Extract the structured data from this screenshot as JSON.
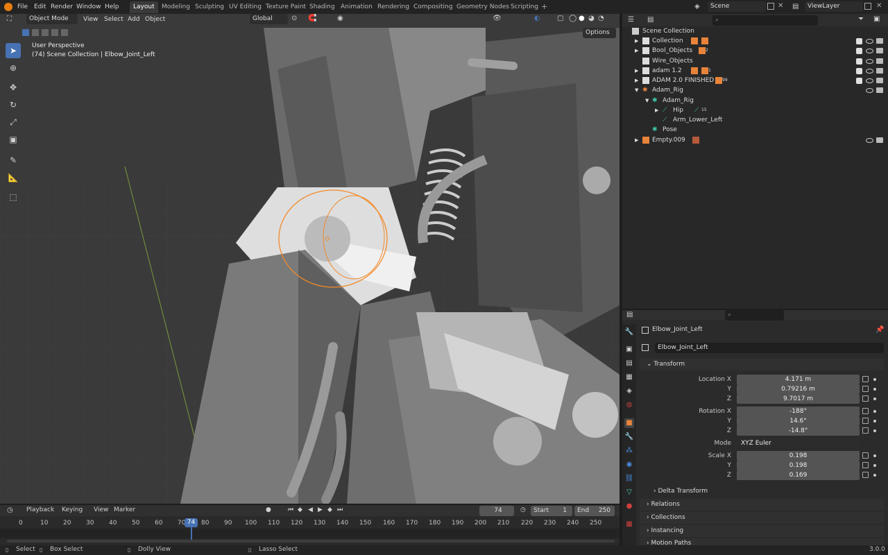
{
  "menu": {
    "file": "File",
    "edit": "Edit",
    "render": "Render",
    "window": "Window",
    "help": "Help"
  },
  "workspaces": [
    "Layout",
    "Modeling",
    "Sculpting",
    "UV Editing",
    "Texture Paint",
    "Shading",
    "Animation",
    "Rendering",
    "Compositing",
    "Geometry Nodes",
    "Scripting"
  ],
  "scene": {
    "name": "Scene",
    "view_layer": "ViewLayer"
  },
  "viewport": {
    "mode": "Object Mode",
    "view": "View",
    "select": "Select",
    "add": "Add",
    "object": "Object",
    "orientation": "Global",
    "options": "Options",
    "perspective": "User Perspective",
    "context": "(74) Scene Collection | Elbow_Joint_Left"
  },
  "outliner": {
    "rows": [
      {
        "label": "Scene Collection",
        "badge": ""
      },
      {
        "label": "Collection",
        "badge": ""
      },
      {
        "label": "Bool_Objects",
        "badge": "2"
      },
      {
        "label": "Wire_Objects",
        "badge": ""
      },
      {
        "label": "adam 1.2",
        "badge": "1"
      },
      {
        "label": "ADAM 2.0 FINISHED",
        "badge": "99"
      },
      {
        "label": "Adam_Rig",
        "badge": ""
      },
      {
        "label": "Adam_Rig",
        "badge": ""
      },
      {
        "label": "Hip",
        "badge": "15"
      },
      {
        "label": "Arm_Lower_Left",
        "badge": ""
      },
      {
        "label": "Pose",
        "badge": ""
      },
      {
        "label": "Empty.009",
        "badge": ""
      }
    ]
  },
  "properties": {
    "object_name": "Elbow_Joint_Left",
    "field_name": "Elbow_Joint_Left",
    "transform": "Transform",
    "location_label": "Location X",
    "loc": [
      "4.171 m",
      "0.79216 m",
      "9.7017 m"
    ],
    "rotation_label": "Rotation X",
    "rot": [
      "-188°",
      "14.6°",
      "-14.8°"
    ],
    "mode_label": "Mode",
    "mode_value": "XYZ Euler",
    "scale_label": "Scale X",
    "scale": [
      "0.198",
      "0.198",
      "0.169"
    ],
    "y": "Y",
    "z": "Z",
    "delta": "Delta Transform",
    "relations": "Relations",
    "collections": "Collections",
    "instancing": "Instancing",
    "motion": "Motion Paths"
  },
  "timeline": {
    "playback": "Playback",
    "keying": "Keying",
    "view": "View",
    "marker": "Marker",
    "current_frame": "74",
    "start_label": "Start",
    "start": "1",
    "end_label": "End",
    "end": "250",
    "ticks": [
      "0",
      "10",
      "20",
      "30",
      "40",
      "50",
      "60",
      "70",
      "80",
      "90",
      "100",
      "110",
      "120",
      "130",
      "140",
      "150",
      "160",
      "170",
      "180",
      "190",
      "200",
      "210",
      "220",
      "230",
      "240",
      "250"
    ],
    "playhead": "74"
  },
  "status": {
    "select": "Select",
    "box_select": "Box Select",
    "dolly": "Dolly View",
    "lasso": "Lasso Select",
    "version": "3.0.0"
  },
  "colors": {
    "accent": "#4772b3",
    "selection": "#f28a2a",
    "bg": "#393939"
  }
}
